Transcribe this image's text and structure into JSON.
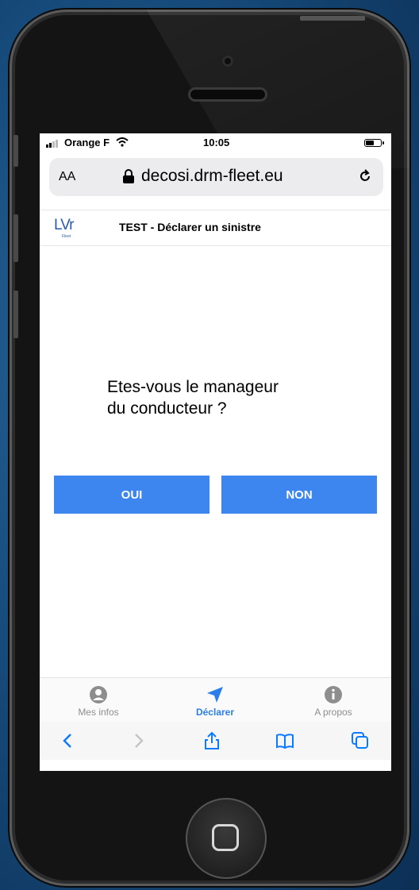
{
  "status_bar": {
    "carrier": "Orange F",
    "time": "10:05"
  },
  "browser": {
    "text_size": "AA",
    "domain": "decosi.drm-fleet.eu"
  },
  "app_header": {
    "logo_text": "LVr",
    "logo_sub": "Fleet",
    "title": "TEST - Déclarer un sinistre"
  },
  "main": {
    "question_line1": "Etes-vous le manageur",
    "question_line2": "du conducteur ?",
    "yes_label": "OUI",
    "no_label": "NON"
  },
  "tabs": [
    {
      "label": "Mes infos",
      "icon": "person-icon"
    },
    {
      "label": "Déclarer",
      "icon": "send-icon"
    },
    {
      "label": "A propos",
      "icon": "info-icon"
    }
  ],
  "colors": {
    "accent": "#3d86ef",
    "active_tab": "#2b7de9",
    "safari_tint": "#0a7aff"
  }
}
